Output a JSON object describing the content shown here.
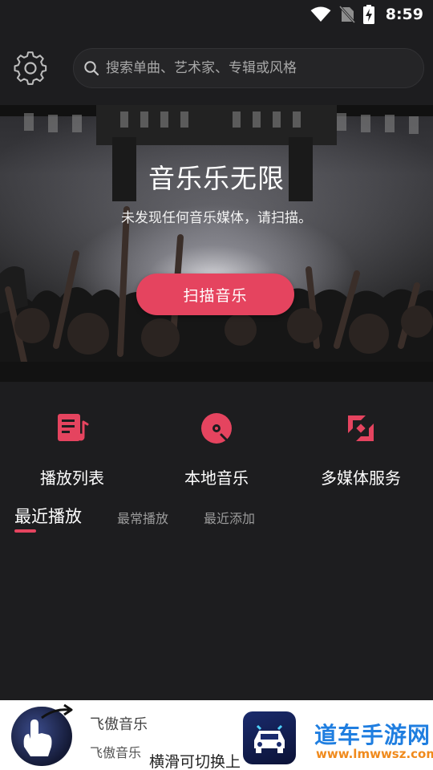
{
  "status_bar": {
    "time": "8:59"
  },
  "header": {
    "search_placeholder": "搜索单曲、艺术家、专辑或风格"
  },
  "hero": {
    "title": "音乐乐无限",
    "subtitle": "未发现任何音乐媒体，请扫描。",
    "scan_button": "扫描音乐"
  },
  "quick_actions": [
    {
      "label": "播放列表",
      "icon": "playlist-icon"
    },
    {
      "label": "本地音乐",
      "icon": "disc-icon"
    },
    {
      "label": "多媒体服务",
      "icon": "media-service-icon"
    }
  ],
  "tabs": [
    {
      "label": "最近播放",
      "active": true
    },
    {
      "label": "最常播放",
      "active": false
    },
    {
      "label": "最近添加",
      "active": false
    }
  ],
  "now_playing": {
    "title": "飞傲音乐",
    "artist": "飞傲音乐",
    "swipe_hint": "横滑可切换上"
  },
  "watermark": {
    "cn": "道车手游网",
    "en": "www.lmwwsz.com"
  },
  "colors": {
    "accent": "#e5445f",
    "background": "#1d1d1f"
  }
}
